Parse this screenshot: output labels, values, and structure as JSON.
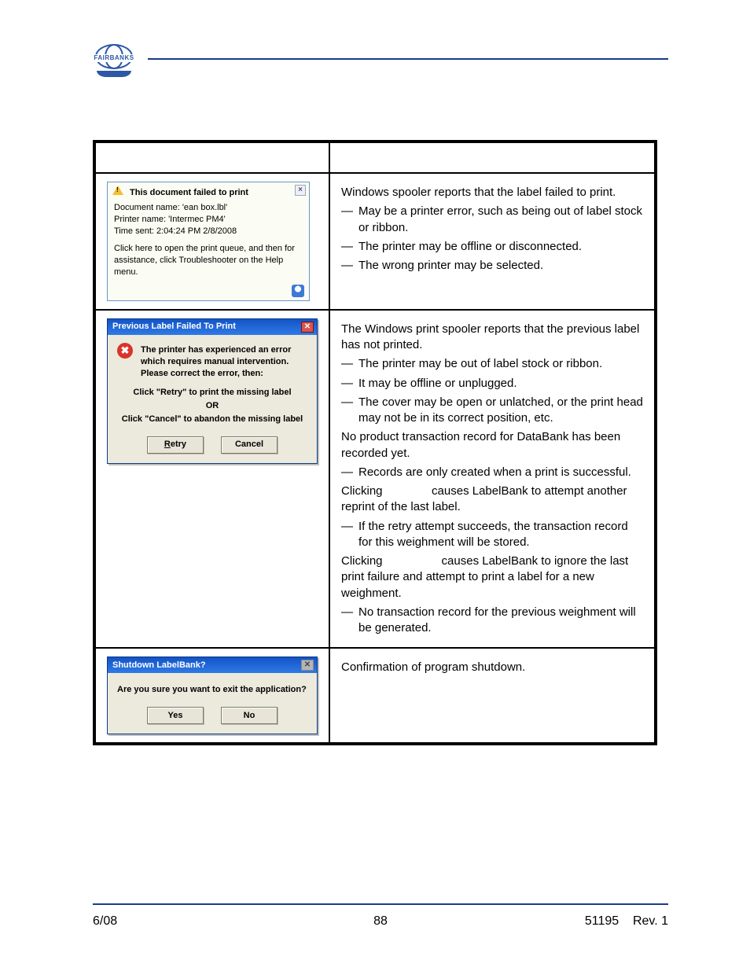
{
  "logo": {
    "brand": "FAIRBANKS"
  },
  "row1": {
    "balloon": {
      "title": "This document failed to print",
      "line_doc": "Document name: 'ean box.lbl'",
      "line_prn": "Printer name: 'Intermec PM4'",
      "line_time": "Time sent: 2:04:24 PM  2/8/2008",
      "hint": "Click here to open the print queue, and then for assistance, click Troubleshooter on the Help menu.",
      "close": "×"
    },
    "desc": {
      "lead": "Windows spooler reports that the label failed to print.",
      "bullets": [
        "May be a printer error, such as being out of label stock or ribbon.",
        "The printer may be offline or disconnected.",
        "The wrong printer may be selected."
      ]
    }
  },
  "row2": {
    "dlg": {
      "title": "Previous Label Failed To Print",
      "msg": "The printer has experienced an error which requires manual intervention. Please correct the error, then:",
      "step1": "Click \"Retry\" to print the missing label",
      "or": "OR",
      "step2": "Click \"Cancel\" to abandon the missing label",
      "btn_retry": "Retry",
      "btn_cancel": "Cancel",
      "retry_u": "R",
      "retry_rest": "etry"
    },
    "desc": {
      "p1": "The Windows print spooler reports that the previous label has not printed.",
      "b1": [
        "The printer may be out of label stock or ribbon.",
        "It may be offline or unplugged.",
        "The cover may be open or unlatched, or the print head may not be in its correct position, etc."
      ],
      "p2": "No product transaction record for DataBank has been recorded yet.",
      "b2": [
        "Records are only created when a print is successful."
      ],
      "p3a": "Clicking ",
      "p3b": " causes LabelBank to attempt another reprint of the last label.",
      "b3": [
        "If the retry attempt succeeds, the transaction record for this weighment will be stored."
      ],
      "p4a": "Clicking ",
      "p4b": " causes LabelBank to ignore the last print failure and attempt to print a label for a new weighment.",
      "b4": [
        "No transaction record for the previous weighment will be generated."
      ]
    }
  },
  "row3": {
    "dlg": {
      "title": "Shutdown LabelBank?",
      "msg": "Are you sure you want to exit the application?",
      "yes": "Yes",
      "no": "No"
    },
    "desc": "Confirmation of program shutdown."
  },
  "footer": {
    "left": "6/08",
    "page": "88",
    "doc": "51195",
    "rev": "Rev. 1"
  }
}
